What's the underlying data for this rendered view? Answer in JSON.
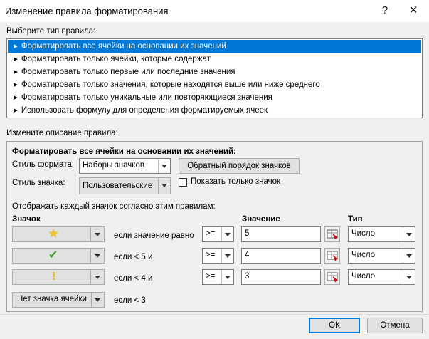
{
  "window": {
    "title": "Изменение правила форматирования",
    "help": "?",
    "close": "✕"
  },
  "select_type_label": "Выберите тип правила:",
  "rule_types": [
    "Форматировать все ячейки на основании их значений",
    "Форматировать только ячейки, которые содержат",
    "Форматировать только первые или последние значения",
    "Форматировать только значения, которые находятся выше или ниже среднего",
    "Форматировать только уникальные или повторяющиеся значения",
    "Использовать формулу для определения форматируемых ячеек"
  ],
  "edit_desc_label": "Измените описание правила:",
  "desc": {
    "heading": "Форматировать все ячейки на основании их значений:",
    "format_style_label": "Стиль формата:",
    "format_style_value": "Наборы значков",
    "reverse_button": "Обратный порядок значков",
    "icon_style_label": "Стиль значка:",
    "icon_style_value": "Пользовательские",
    "show_icon_only_label": "Показать только значок",
    "show_icon_only_checked": false,
    "rules_intro": "Отображать каждый значок согласно этим правилам:",
    "col_icon": "Значок",
    "col_value": "Значение",
    "col_type": "Тип",
    "rows": [
      {
        "icon": "star-icon",
        "icon_color": "#f3c623",
        "condition": "если значение равно",
        "op": ">=",
        "value": "5",
        "type": "Число"
      },
      {
        "icon": "check-icon",
        "icon_color": "#3a9a28",
        "condition": "если < 5 и",
        "op": ">=",
        "value": "4",
        "type": "Число"
      },
      {
        "icon": "exclamation-icon",
        "icon_color": "#f3b10f",
        "condition": "если < 4 и",
        "op": ">=",
        "value": "3",
        "type": "Число"
      }
    ],
    "last_row": {
      "icon_label": "Нет значка ячейки",
      "condition": "если < 3"
    }
  },
  "buttons": {
    "ok": "ОК",
    "cancel": "Отмена"
  }
}
